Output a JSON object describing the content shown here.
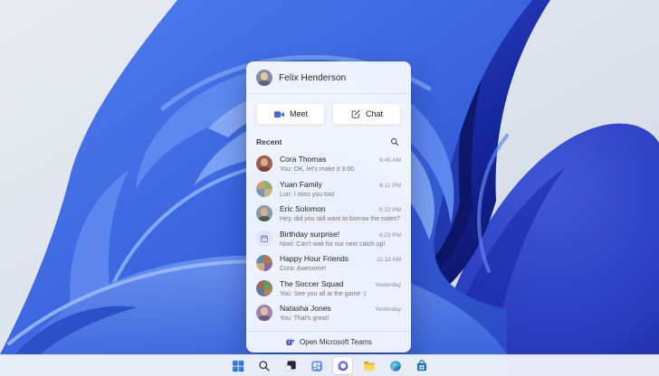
{
  "colors": {
    "accent_blue": "#3e6ce0",
    "teams_purple": "#4b53bc",
    "panel_background": "#fbfcfe",
    "taskbar_background": "#f3f5fa",
    "wallpaper_light_bg": "#dfe4ec",
    "wallpaper_petal_blue": "#4a77e9",
    "wallpaper_dark_navy": "#101c74"
  },
  "panel": {
    "header": {
      "name": "Felix Henderson"
    },
    "actions": {
      "meet_label": "Meet",
      "chat_label": "Chat"
    },
    "recent": {
      "label": "Recent",
      "search_icon": "search-icon",
      "items": [
        {
          "name": "Cora Thomas",
          "preview": "You: OK, let's make it 3:00.",
          "time": "8:45 AM",
          "avatar": "photo-woman"
        },
        {
          "name": "Yuan Family",
          "preview": "Lun: I miss you too!",
          "time": "6:11 PM",
          "avatar": "group-photo-collage"
        },
        {
          "name": "Eric Solomon",
          "preview": "Hey, did you still want to borrow the notes?",
          "time": "5:22 PM",
          "avatar": "photo-man"
        },
        {
          "name": "Birthday surprise!",
          "preview": "Noel: Can't wait for our next catch up!",
          "time": "4:23 PM",
          "avatar": "calendar-icon"
        },
        {
          "name": "Happy Hour Friends",
          "preview": "Cora: Awesome!",
          "time": "11:16 AM",
          "avatar": "group-photo-collage"
        },
        {
          "name": "The Soccer Squad",
          "preview": "You: See you all at the game :)",
          "time": "Yesterday",
          "avatar": "group-photo-collage"
        },
        {
          "name": "Natasha Jones",
          "preview": "You: That's great!",
          "time": "Yesterday",
          "avatar": "photo-woman"
        }
      ]
    },
    "footer": {
      "label": "Open Microsoft Teams",
      "icon": "teams-icon"
    }
  },
  "taskbar": {
    "icons": [
      "start",
      "search",
      "task-view",
      "widgets",
      "teams-chat",
      "file-explorer",
      "edge",
      "microsoft-store"
    ],
    "active_icon": "teams-chat"
  }
}
